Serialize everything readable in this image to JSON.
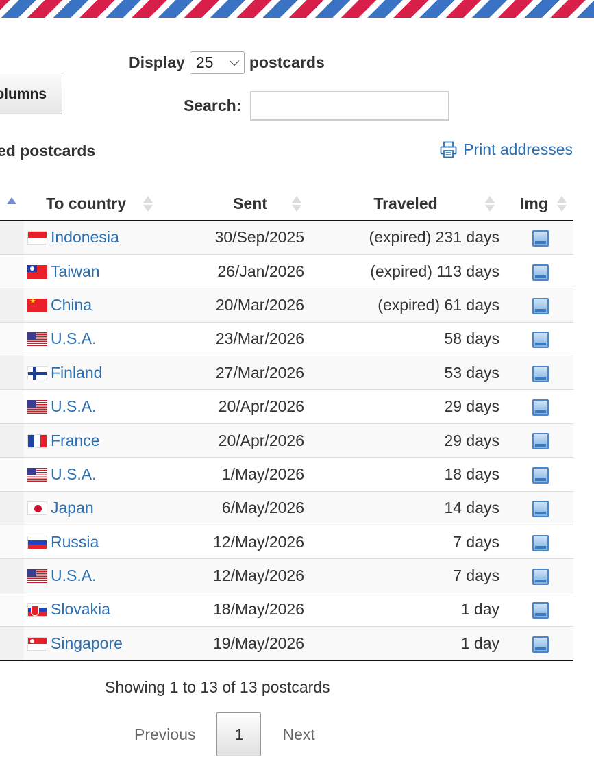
{
  "colors": {
    "accent": "#2c6fb1",
    "airmail_red": "#d81f4a",
    "airmail_blue": "#3a72c4"
  },
  "controls": {
    "display_label": "Display",
    "display_value": "25",
    "display_suffix": "postcards",
    "columns_button": "olumns",
    "search_label": "Search:",
    "search_value": ""
  },
  "section": {
    "title": "ed postcards",
    "print_label": "Print addresses",
    "print_icon": "printer-icon"
  },
  "table": {
    "headers": {
      "country": "To country",
      "sent": "Sent",
      "traveled": "Traveled",
      "img": "Img"
    },
    "rows": [
      {
        "flag": "f-id",
        "country": "Indonesia",
        "sent": "30/Sep/2025",
        "traveled": "(expired) 231 days"
      },
      {
        "flag": "f-tw",
        "country": "Taiwan",
        "sent": "26/Jan/2026",
        "traveled": "(expired) 113 days"
      },
      {
        "flag": "f-cn",
        "country": "China",
        "sent": "20/Mar/2026",
        "traveled": "(expired) 61 days"
      },
      {
        "flag": "f-us",
        "country": "U.S.A.",
        "sent": "23/Mar/2026",
        "traveled": "58 days"
      },
      {
        "flag": "f-fi",
        "country": "Finland",
        "sent": "27/Mar/2026",
        "traveled": "53 days"
      },
      {
        "flag": "f-us",
        "country": "U.S.A.",
        "sent": "20/Apr/2026",
        "traveled": "29 days"
      },
      {
        "flag": "f-fr",
        "country": "France",
        "sent": "20/Apr/2026",
        "traveled": "29 days"
      },
      {
        "flag": "f-us",
        "country": "U.S.A.",
        "sent": "1/May/2026",
        "traveled": "18 days"
      },
      {
        "flag": "f-jp",
        "country": "Japan",
        "sent": "6/May/2026",
        "traveled": "14 days"
      },
      {
        "flag": "f-ru",
        "country": "Russia",
        "sent": "12/May/2026",
        "traveled": "7 days"
      },
      {
        "flag": "f-us",
        "country": "U.S.A.",
        "sent": "12/May/2026",
        "traveled": "7 days"
      },
      {
        "flag": "f-sk",
        "country": "Slovakia",
        "sent": "18/May/2026",
        "traveled": "1 day"
      },
      {
        "flag": "f-sg",
        "country": "Singapore",
        "sent": "19/May/2026",
        "traveled": "1 day"
      }
    ]
  },
  "footer": {
    "info": "Showing 1 to 13 of 13 postcards",
    "previous": "Previous",
    "page": "1",
    "next": "Next"
  }
}
